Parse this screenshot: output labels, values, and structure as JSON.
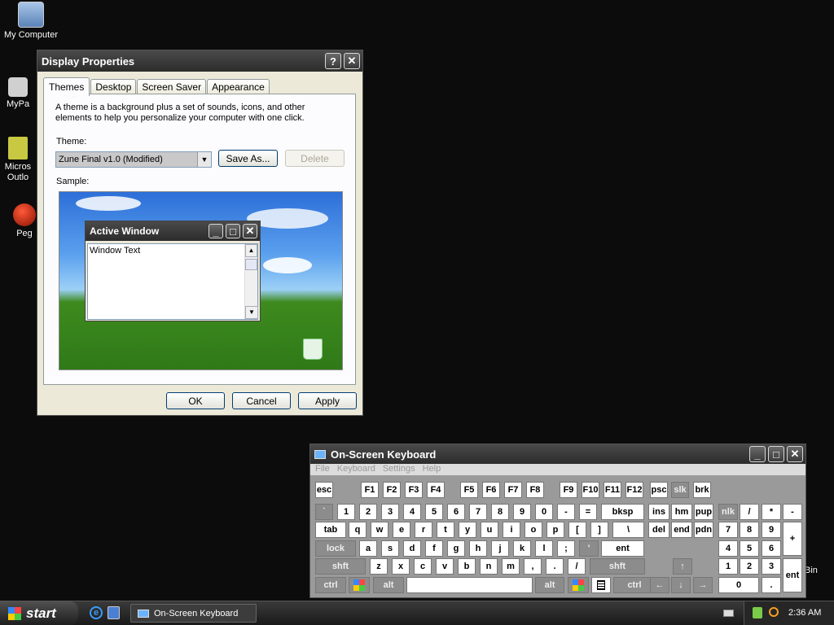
{
  "desktop": {
    "icons": [
      {
        "label": "My Computer"
      },
      {
        "label": "MyPa"
      },
      {
        "label": "Micros\nOutlo"
      },
      {
        "label": "Peg"
      }
    ],
    "partial_bin": "Bin"
  },
  "display_props": {
    "title": "Display Properties",
    "help_btn": "?",
    "close_btn": "✕",
    "tabs": [
      "Themes",
      "Desktop",
      "Screen Saver",
      "Appearance"
    ],
    "description": "A theme is a background plus a set of sounds, icons, and other elements to help you personalize your computer with one click.",
    "theme_label": "Theme:",
    "theme_value": "Zune Final v1.0 (Modified)",
    "save_as": "Save As...",
    "delete": "Delete",
    "sample_label": "Sample:",
    "preview": {
      "window_title": "Active Window",
      "window_text": "Window Text"
    },
    "ok": "OK",
    "cancel": "Cancel",
    "apply": "Apply"
  },
  "osk": {
    "title": "On-Screen Keyboard",
    "menu": [
      "File",
      "Keyboard",
      "Settings",
      "Help"
    ],
    "rows": {
      "fn": [
        "esc",
        "F1",
        "F2",
        "F3",
        "F4",
        "F5",
        "F6",
        "F7",
        "F8",
        "F9",
        "F10",
        "F11",
        "F12",
        "psc",
        "slk",
        "brk"
      ],
      "num": [
        "`",
        "1",
        "2",
        "3",
        "4",
        "5",
        "6",
        "7",
        "8",
        "9",
        "0",
        "-",
        "=",
        "bksp",
        "ins",
        "hm",
        "pup",
        "nlk",
        "/",
        "*",
        "-"
      ],
      "q": [
        "tab",
        "q",
        "w",
        "e",
        "r",
        "t",
        "y",
        "u",
        "i",
        "o",
        "p",
        "[",
        "]",
        "\\",
        "del",
        "end",
        "pdn",
        "7",
        "8",
        "9",
        "+"
      ],
      "a": [
        "lock",
        "a",
        "s",
        "d",
        "f",
        "g",
        "h",
        "j",
        "k",
        "l",
        ";",
        "'",
        "ent",
        "4",
        "5",
        "6"
      ],
      "z": [
        "shft",
        "z",
        "x",
        "c",
        "v",
        "b",
        "n",
        "m",
        ",",
        ".",
        "/",
        "shft",
        "↑",
        "1",
        "2",
        "3",
        "ent"
      ],
      "b": [
        "ctrl",
        "win",
        "alt",
        "",
        "alt",
        "win",
        "menu",
        "ctrl",
        "←",
        "↓",
        "→",
        "0",
        "."
      ]
    }
  },
  "taskbar": {
    "start": "start",
    "task": "On-Screen Keyboard",
    "clock": "2:36 AM"
  },
  "colors": {
    "accent": "#2b2b2b",
    "start_green": "#3c8a3c"
  }
}
